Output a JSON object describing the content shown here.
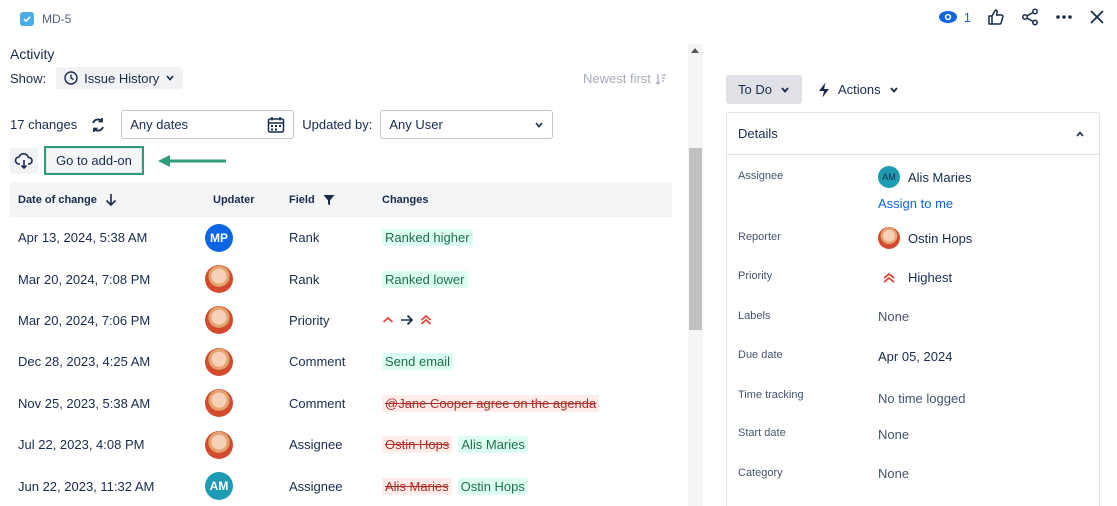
{
  "header": {
    "issue_key": "MD-5",
    "watch_count": "1"
  },
  "activity": {
    "title": "Activity",
    "show_label": "Show:",
    "history_button": "Issue History",
    "sort_label": "Newest first"
  },
  "filters": {
    "changes_count": "17 changes",
    "dates_value": "Any dates",
    "updated_by_label": "Updated by:",
    "user_value": "Any User"
  },
  "addon": {
    "button_label": "Go to add-on"
  },
  "table": {
    "headers": {
      "date": "Date of change",
      "updater": "Updater",
      "field": "Field",
      "changes": "Changes"
    },
    "rows": [
      {
        "date": "Apr 13, 2024, 5:38 AM",
        "updater": "MP",
        "field": "Rank",
        "added": "Ranked higher",
        "removed": ""
      },
      {
        "date": "Mar 20, 2024, 7:08 PM",
        "updater": "",
        "field": "Rank",
        "added": "Ranked lower",
        "removed": ""
      },
      {
        "date": "Mar 20, 2024, 7:06 PM",
        "updater": "",
        "field": "Priority",
        "added": "",
        "removed": ""
      },
      {
        "date": "Dec 28, 2023, 4:25 AM",
        "updater": "",
        "field": "Comment",
        "added": "Send email",
        "removed": ""
      },
      {
        "date": "Nov 25, 2023, 5:38 AM",
        "updater": "",
        "field": "Comment",
        "added": "",
        "removed": "@Jane Cooper agree on the agenda"
      },
      {
        "date": "Jul 22, 2023, 4:08 PM",
        "updater": "",
        "field": "Assignee",
        "added": "Alis Maries",
        "removed": "Ostin Hops"
      },
      {
        "date": "Jun 22, 2023, 11:32 AM",
        "updater": "AM",
        "field": "Assignee",
        "added": "Ostin Hops",
        "removed": "Alis Maries"
      }
    ]
  },
  "status": {
    "label": "To Do",
    "actions_label": "Actions"
  },
  "details": {
    "title": "Details",
    "assignee_label": "Assignee",
    "assignee_value": "Alis Maries",
    "assignee_initials": "AM",
    "assign_to_me": "Assign to me",
    "reporter_label": "Reporter",
    "reporter_value": "Ostin Hops",
    "priority_label": "Priority",
    "priority_value": "Highest",
    "labels_label": "Labels",
    "labels_value": "None",
    "due_label": "Due date",
    "due_value": "Apr 05, 2024",
    "time_label": "Time tracking",
    "time_value": "No time logged",
    "start_label": "Start date",
    "start_value": "None",
    "category_label": "Category",
    "category_value": "None"
  },
  "colors": {
    "accent": "#0c66e4",
    "addon_border": "#2e9b7a",
    "added_bg": "#dcfff1",
    "removed_bg": "#ffeceb",
    "priority": "#e2483d"
  }
}
